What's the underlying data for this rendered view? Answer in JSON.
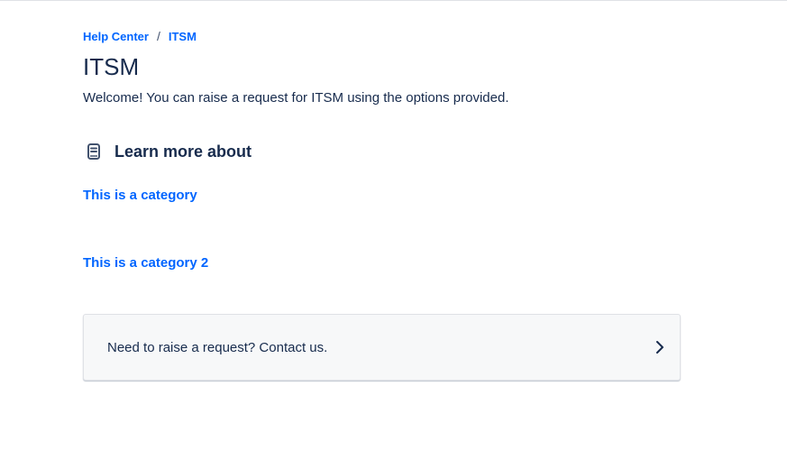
{
  "breadcrumb": {
    "items": [
      "Help Center",
      "ITSM"
    ],
    "separator": "/"
  },
  "page": {
    "title": "ITSM",
    "welcome": "Welcome! You can raise a request for ITSM using the options provided."
  },
  "section": {
    "title": "Learn more about",
    "icon": "book-icon"
  },
  "categories": [
    {
      "label": "This is a category"
    },
    {
      "label": "This is a category 2"
    }
  ],
  "contact_card": {
    "label": "Need to raise a request? Contact us.",
    "icon": "chevron-right-icon"
  },
  "colors": {
    "link": "#0065ff",
    "text": "#172b4d",
    "card_bg": "#f7f8f9",
    "border": "#dfe1e6"
  }
}
